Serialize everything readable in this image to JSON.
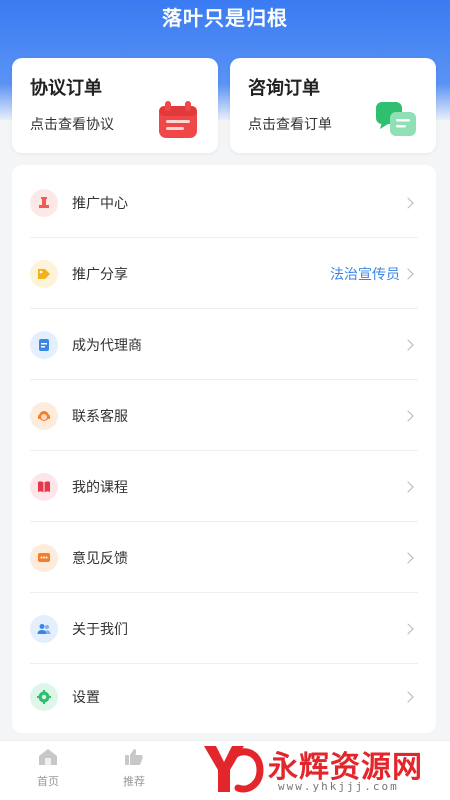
{
  "header": {
    "title": "落叶只是归根"
  },
  "orders": [
    {
      "title": "协议订单",
      "subtitle": "点击查看协议",
      "icon": "calendar-icon",
      "color": "#f04848"
    },
    {
      "title": "咨询订单",
      "subtitle": "点击查看订单",
      "icon": "chat-bubbles-icon",
      "color": "#2fbf71"
    }
  ],
  "menu": {
    "items": [
      {
        "label": "推广中心",
        "icon": "promotion-icon",
        "color": "#f25a5a",
        "extra": ""
      },
      {
        "label": "推广分享",
        "icon": "tag-icon",
        "color": "#f3b21b",
        "extra": "法治宣传员"
      },
      {
        "label": "成为代理商",
        "icon": "document-icon",
        "color": "#3a86e6",
        "extra": ""
      },
      {
        "label": "联系客服",
        "icon": "customer-service-icon",
        "color": "#f27f2b",
        "extra": ""
      },
      {
        "label": "我的课程",
        "icon": "book-icon",
        "color": "#e8364a",
        "extra": ""
      },
      {
        "label": "意见反馈",
        "icon": "feedback-icon",
        "color": "#f27f2b",
        "extra": ""
      },
      {
        "label": "关于我们",
        "icon": "users-icon",
        "color": "#3a86e6",
        "extra": ""
      },
      {
        "label": "设置",
        "icon": "gear-icon",
        "color": "#2fbf71",
        "extra": ""
      }
    ]
  },
  "tabbar": {
    "items": [
      {
        "label": "首页",
        "icon": "home-icon"
      },
      {
        "label": "推荐",
        "icon": "thumbs-up-icon"
      }
    ]
  },
  "watermark": {
    "text": "永辉资源网",
    "url": "www.yhkjjj.com"
  }
}
